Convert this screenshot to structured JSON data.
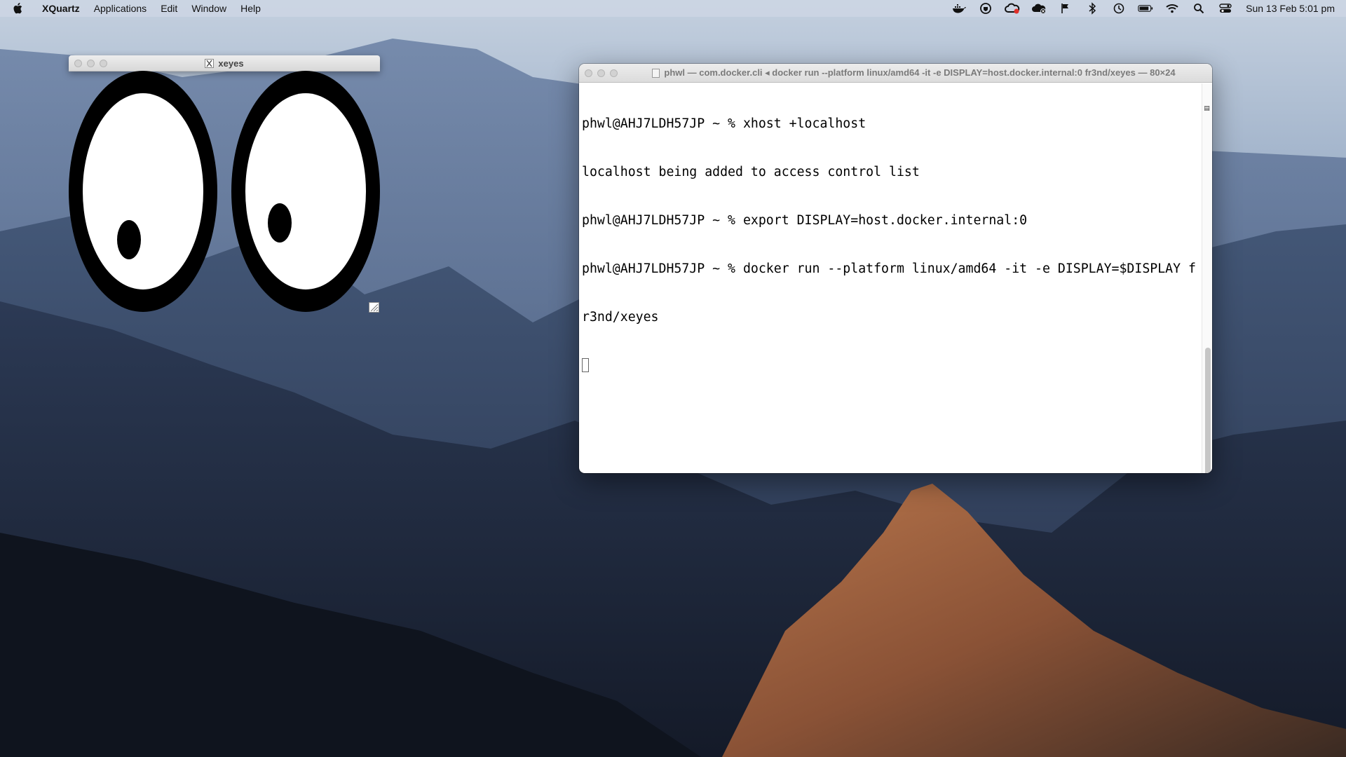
{
  "menubar": {
    "app_name": "XQuartz",
    "items": [
      "Applications",
      "Edit",
      "Window",
      "Help"
    ],
    "clock": "Sun 13 Feb  5:01 pm",
    "status_icons": [
      "docker-icon",
      "vpn-icon",
      "creative-cloud-icon",
      "cloud-sync-icon",
      "flag-icon",
      "bluetooth-icon",
      "time-machine-icon",
      "battery-icon",
      "wifi-icon",
      "spotlight-icon",
      "control-center-icon"
    ]
  },
  "xeyes_window": {
    "title": "xeyes"
  },
  "terminal": {
    "title": "phwl — com.docker.cli ◂ docker run --platform linux/amd64 -it -e DISPLAY=host.docker.internal:0 fr3nd/xeyes — 80×24",
    "lines": [
      "phwl@AHJ7LDH57JP ~ % xhost +localhost",
      "localhost being added to access control list",
      "phwl@AHJ7LDH57JP ~ % export DISPLAY=host.docker.internal:0",
      "phwl@AHJ7LDH57JP ~ % docker run --platform linux/amd64 -it -e DISPLAY=$DISPLAY f",
      "r3nd/xeyes"
    ]
  }
}
